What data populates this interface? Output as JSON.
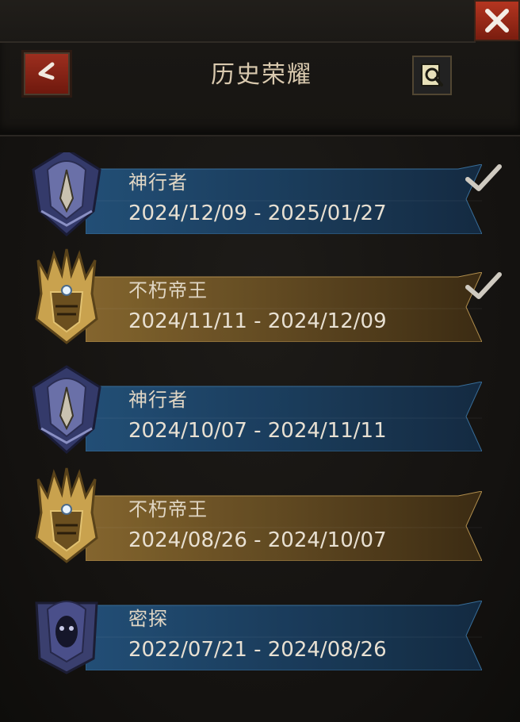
{
  "header": {
    "title": "历史荣耀",
    "back_icon": "chevron-left-icon",
    "info_icon": "search-record-icon",
    "close_icon": "close-icon"
  },
  "colors": {
    "blue_banner": "#1f4b73",
    "gold_banner": "#7a5a26",
    "close_red": "#b43520"
  },
  "entries": [
    {
      "name": "神行者",
      "dates": "2024/12/09 - 2025/01/27",
      "theme": "blue",
      "emblem": "hooded-assassin-emblem",
      "claimed": true
    },
    {
      "name": "不朽帝王",
      "dates": "2024/11/11 - 2024/12/09",
      "theme": "gold",
      "emblem": "golden-crown-helm-emblem",
      "claimed": true
    },
    {
      "name": "神行者",
      "dates": "2024/10/07 - 2024/11/11",
      "theme": "blue",
      "emblem": "hooded-assassin-emblem",
      "claimed": false
    },
    {
      "name": "不朽帝王",
      "dates": "2024/08/26 - 2024/10/07",
      "theme": "gold",
      "emblem": "golden-crown-helm-emblem",
      "claimed": false
    },
    {
      "name": "密探",
      "dates": "2022/07/21 - 2024/08/26",
      "theme": "blue",
      "emblem": "hooded-spy-emblem",
      "claimed": false
    }
  ]
}
